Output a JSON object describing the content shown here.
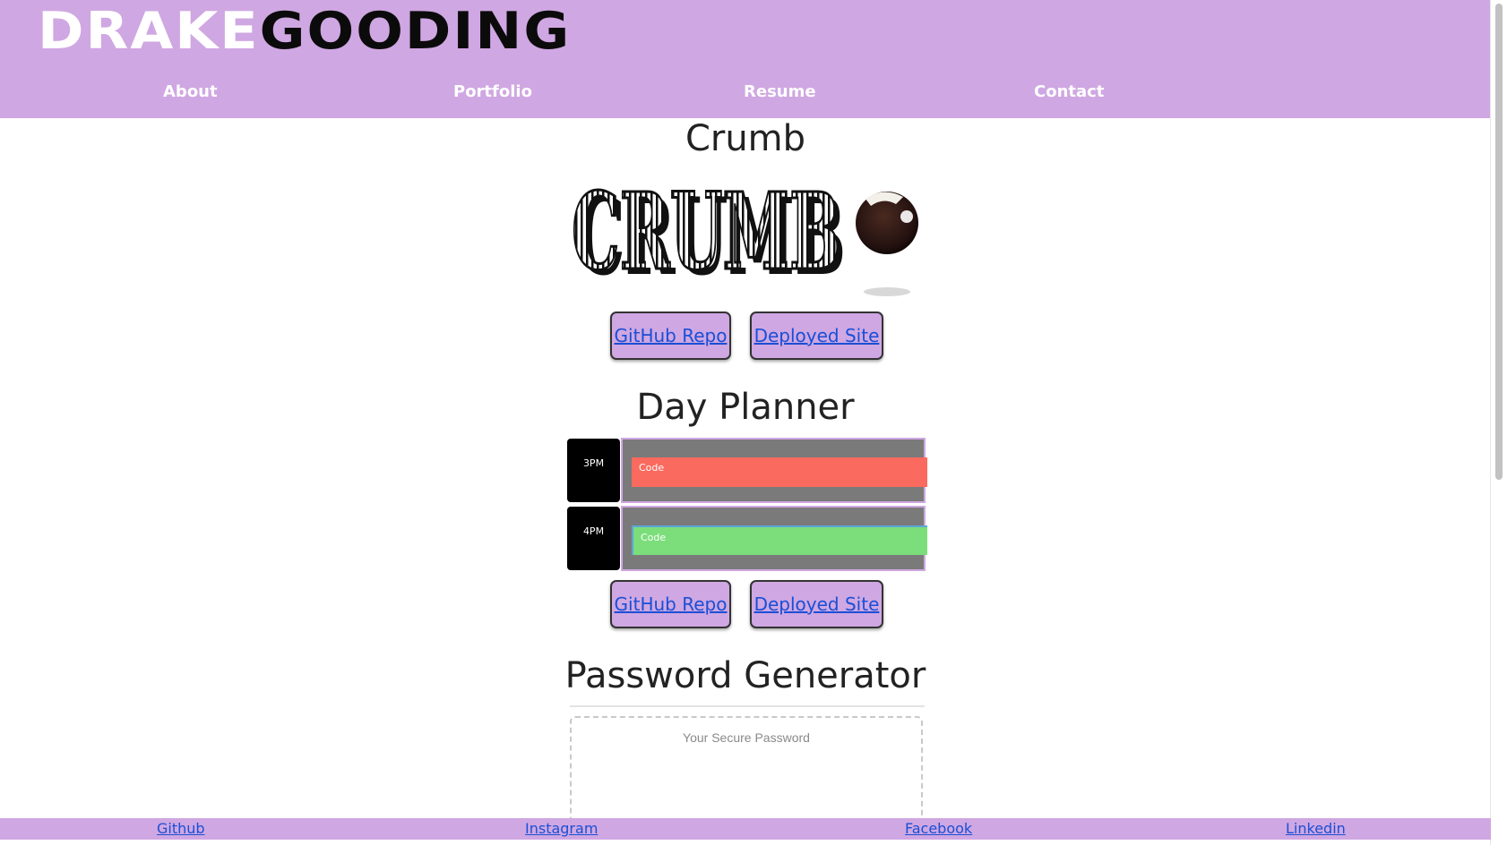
{
  "header": {
    "logo_part1": "DRAKE",
    "logo_part2": "GOODING",
    "nav": [
      "About",
      "Portfolio",
      "Resume",
      "Contact"
    ]
  },
  "projects": [
    {
      "title": "Crumb",
      "image_text": "CRUMB",
      "repo_label": "GitHub Repo",
      "site_label": "Deployed Site"
    },
    {
      "title": "Day Planner",
      "planner": [
        {
          "hour": "3PM",
          "task": "Code",
          "status": "past"
        },
        {
          "hour": "4PM",
          "task": "Code",
          "status": "future"
        }
      ],
      "repo_label": "GitHub Repo",
      "site_label": "Deployed Site"
    },
    {
      "title": "Password Generator",
      "placeholder": "Your Secure Password"
    }
  ],
  "footer": {
    "links": [
      "Github",
      "Instagram",
      "Facebook",
      "Linkedin"
    ]
  },
  "colors": {
    "accent": "#cfa7e2",
    "link": "#1a4fd6",
    "past": "#fb6a5e",
    "future": "#7bde7a"
  }
}
